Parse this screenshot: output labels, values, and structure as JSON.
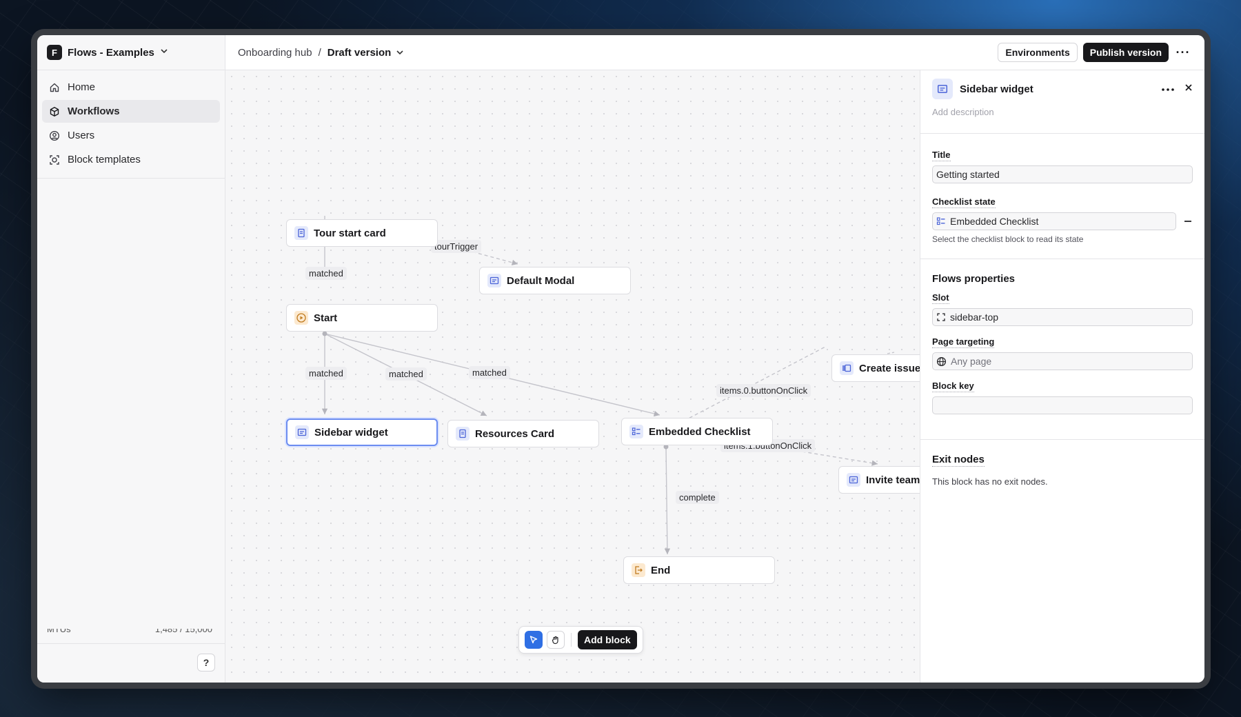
{
  "org": {
    "logo_letter": "F",
    "name": "Flows - Examples"
  },
  "nav": {
    "items": [
      {
        "label": "Home",
        "icon": "home-icon"
      },
      {
        "label": "Workflows",
        "icon": "cube-icon",
        "active": true
      },
      {
        "label": "Users",
        "icon": "user-circle-icon"
      },
      {
        "label": "Block templates",
        "icon": "template-icon"
      }
    ]
  },
  "sidebar_footer": {
    "help_label": "?",
    "mtu_label": "MTUs",
    "mtu_value": "1,485 / 15,000"
  },
  "breadcrumb": {
    "parent": "Onboarding hub",
    "separator": "/",
    "current": "Draft version"
  },
  "top_actions": {
    "environments_label": "Environments",
    "publish_label": "Publish version",
    "more_label": "···"
  },
  "canvas": {
    "nodes": [
      {
        "id": "tour-start-card",
        "label": "Tour start card",
        "icon": "card-icon"
      },
      {
        "id": "default-modal",
        "label": "Default Modal",
        "icon": "modal-icon"
      },
      {
        "id": "start",
        "label": "Start",
        "icon": "play-icon"
      },
      {
        "id": "sidebar-widget",
        "label": "Sidebar widget",
        "icon": "modal-icon",
        "selected": true
      },
      {
        "id": "resources-card",
        "label": "Resources Card",
        "icon": "card-icon"
      },
      {
        "id": "embedded-checklist",
        "label": "Embedded Checklist",
        "icon": "checklist-icon"
      },
      {
        "id": "create-issue-tour",
        "label": "Create issue tour",
        "icon": "tour-icon"
      },
      {
        "id": "invite-team-members",
        "label": "Invite team members",
        "icon": "modal-icon"
      },
      {
        "id": "end",
        "label": "End",
        "icon": "exit-icon"
      }
    ],
    "edge_labels": {
      "tour_trigger": "tourTrigger",
      "matched_1": "matched",
      "matched_2": "matched",
      "matched_3": "matched",
      "matched_4": "matched",
      "items0": "items.0.buttonOnClick",
      "items1": "items.1.buttonOnClick",
      "complete": "complete"
    },
    "toolbar": {
      "add_block_label": "Add block"
    }
  },
  "panel": {
    "title": "Sidebar widget",
    "description_placeholder": "Add description",
    "fields": {
      "title_label": "Title",
      "title_value": "Getting started",
      "checklist_label": "Checklist state",
      "checklist_value": "Embedded Checklist",
      "checklist_help": "Select the checklist block to read its state"
    },
    "flows_properties": {
      "heading": "Flows properties",
      "slot_label": "Slot",
      "slot_value": "sidebar-top",
      "page_targeting_label": "Page targeting",
      "page_targeting_value": "Any page",
      "block_key_label": "Block key",
      "block_key_value": ""
    },
    "exit_nodes": {
      "heading": "Exit nodes",
      "empty_text": "This block has no exit nodes."
    }
  },
  "colors": {
    "accent": "#2f6fe4",
    "selected_border": "#6b8cf0",
    "dark": "#18181b"
  }
}
